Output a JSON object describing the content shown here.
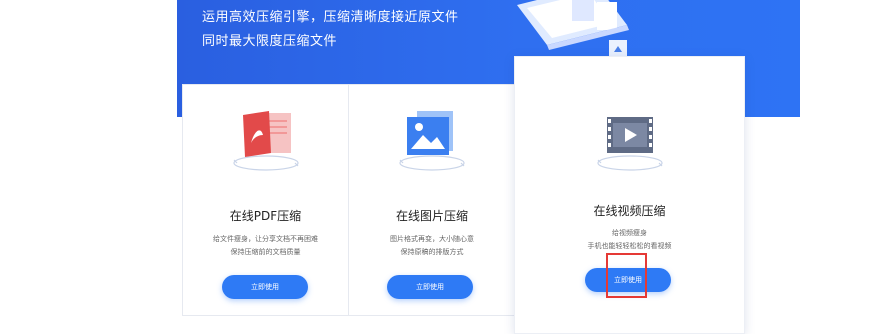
{
  "banner": {
    "line1": "运用高效压缩引擎，压缩清晰度接近原文件",
    "line2": "同时最大限度压缩文件"
  },
  "cards": [
    {
      "title": "在线PDF压缩",
      "desc1": "给文件瘦身，让分享文档不再困难",
      "desc2": "保持压缩前的文档质量",
      "button": "立即使用",
      "icon": "pdf-file-icon"
    },
    {
      "title": "在线图片压缩",
      "desc1": "图片格式再变，大小随心意",
      "desc2": "保持原稿的排版方式",
      "button": "立即使用",
      "icon": "image-file-icon"
    },
    {
      "title": "在线视频压缩",
      "desc1": "给视频瘦身",
      "desc2": "手机也能轻轻松松的看视频",
      "button": "立即使用",
      "icon": "video-file-icon"
    }
  ],
  "colors": {
    "banner": "#2f6ff0",
    "button": "#2e7af5",
    "highlight": "#e53935"
  }
}
